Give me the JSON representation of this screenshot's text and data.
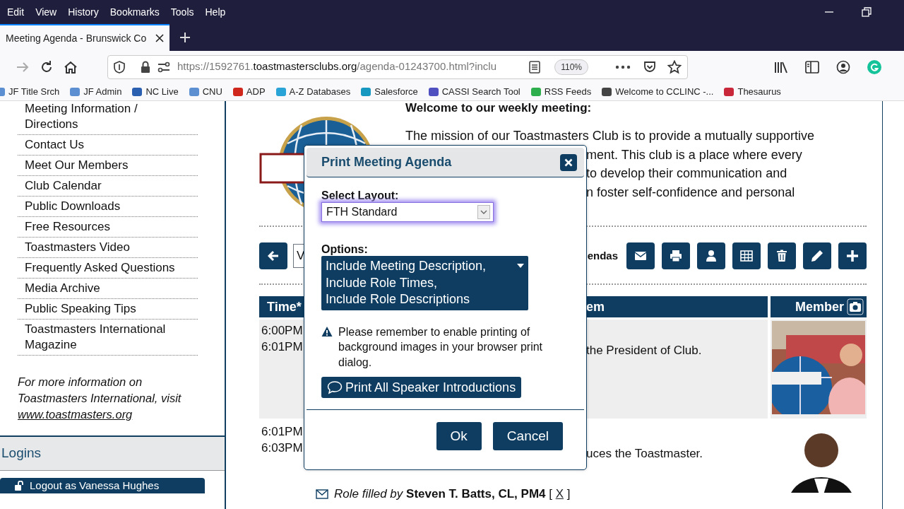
{
  "browser": {
    "menu": [
      "Edit",
      "View",
      "History",
      "Bookmarks",
      "Tools",
      "Help"
    ],
    "tab": {
      "title": "Meeting Agenda - Brunswick Co",
      "selected": true
    },
    "url": {
      "prefix": "https://1592761.",
      "domain": "toastmastersclubs.org",
      "rest": "/agenda-01243700.html?inclu"
    },
    "zoom": "110%",
    "bookmarks": [
      {
        "label": "JF Title Srch",
        "color": "#5b8fd1"
      },
      {
        "label": "JF Admin",
        "color": "#5b8fd1"
      },
      {
        "label": "NC Live",
        "color": "#2b5fb0"
      },
      {
        "label": "CNU",
        "color": "#5b8fd1"
      },
      {
        "label": "ADP",
        "color": "#d0271d"
      },
      {
        "label": "A-Z Databases",
        "color": "#2aa3d6"
      },
      {
        "label": "Salesforce",
        "color": "#1798c1"
      },
      {
        "label": "CASSI Search Tool",
        "color": "#5050c0"
      },
      {
        "label": "RSS Feeds",
        "color": "#2fae4e"
      },
      {
        "label": "Welcome to CCLINC -...",
        "color": "#444444"
      },
      {
        "label": "Thesaurus",
        "color": "#c8283a"
      }
    ]
  },
  "sidebar": {
    "items": [
      "Meeting Information / Directions",
      "Contact Us",
      "Meet Our Members",
      "Club Calendar",
      "Public Downloads",
      "Free Resources",
      "Toastmasters Video",
      "Frequently Asked Questions",
      "Media Archive",
      "Public Speaking Tips",
      "Toastmasters International Magazine"
    ],
    "note": "For more information on Toastmasters International, visit",
    "note_link": "www.toastmasters.org",
    "logins_title": "Logins",
    "logout_button": "Logout as Vanessa Hughes"
  },
  "page": {
    "heading": "Welcome to our weekly meeting:",
    "mission_lines": [
      "The mission of our Toastmasters Club is to provide a mutually supportive",
      "ment. This club is a place where every",
      "to develop their communication and",
      "n foster self-confidence and personal"
    ],
    "toolbar": {
      "field_value": "V",
      "label": "endas"
    },
    "table": {
      "columns": [
        "Time*",
        "em",
        "Member"
      ],
      "rows": [
        {
          "times": [
            "6:00PM",
            "6:01PM"
          ],
          "item": "the President of Club.",
          "shaded": true
        },
        {
          "times": [
            "6:01PM",
            "6:03PM"
          ],
          "item": "uces the Toastmaster.",
          "shaded": false
        }
      ]
    },
    "role_note": {
      "text": "*Role filled by* **Steven T. Batts, CL, PM4** [",
      "link": "X",
      "close": "]"
    }
  },
  "dialog": {
    "title": "Print Meeting Agenda",
    "layout_label": "Select Layout:",
    "layout_value": "FTH Standard",
    "layout_focused": true,
    "options_label": "Options:",
    "options_value": [
      "Include Meeting Description,",
      "Include Role Times,",
      "Include Role Descriptions"
    ],
    "warning": "Please remember to enable printing of background images in your browser print dialog.",
    "intro_button": "Print All Speaker Introductions",
    "buttons": [
      "Ok",
      "Cancel"
    ]
  }
}
